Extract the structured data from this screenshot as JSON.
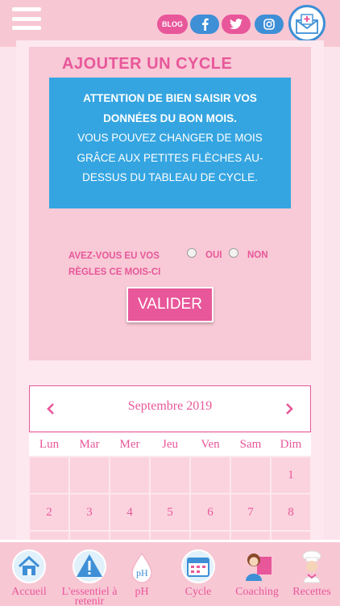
{
  "header": {
    "blog_label": "BLOG",
    "menu_icon": "hamburger-icon",
    "social_icons": [
      "facebook-icon",
      "twitter-icon",
      "instagram-icon"
    ],
    "mail_icon": "mail-icon"
  },
  "form": {
    "title": "AJOUTER UN CYCLE",
    "notice_line1": "ATTENTION DE BIEN SAISIR VOS",
    "notice_line2": "DONNÉES DU BON MOIS.",
    "notice_line3": "VOUS POUVEZ CHANGER DE MOIS",
    "notice_line4": "GRÂCE AUX PETITES FLÈCHES AU-",
    "notice_line5": "DESSUS DU TABLEAU DE CYCLE.",
    "question_line1": "AVEZ-VOUS EU VOS",
    "question_line2": "RÈGLES CE MOIS-CI",
    "option_yes": "OUI",
    "option_no": "NON",
    "submit_label": "VALIDER"
  },
  "calendar": {
    "month": "Septembre 2019",
    "weekdays": [
      "Lun",
      "Mar",
      "Mer",
      "Jeu",
      "Ven",
      "Sam",
      "Dim"
    ],
    "row1": [
      "",
      "",
      "",
      "",
      "",
      "",
      "1"
    ],
    "row2": [
      "2",
      "3",
      "4",
      "5",
      "6",
      "7",
      "8"
    ]
  },
  "colors": {
    "accent": "#e8579a",
    "notice_bg": "#35a5e1",
    "panel_bg": "#f8c9d6"
  },
  "bottom_nav": [
    {
      "label": "Accueil",
      "icon": "home-icon"
    },
    {
      "label": "L'essentiel à retenir",
      "icon": "warning-icon"
    },
    {
      "label": "pH",
      "icon": "ph-drop-icon"
    },
    {
      "label": "Cycle",
      "icon": "calendar-icon"
    },
    {
      "label": "Coaching",
      "icon": "coach-icon"
    },
    {
      "label": "Recettes",
      "icon": "chef-icon"
    }
  ]
}
